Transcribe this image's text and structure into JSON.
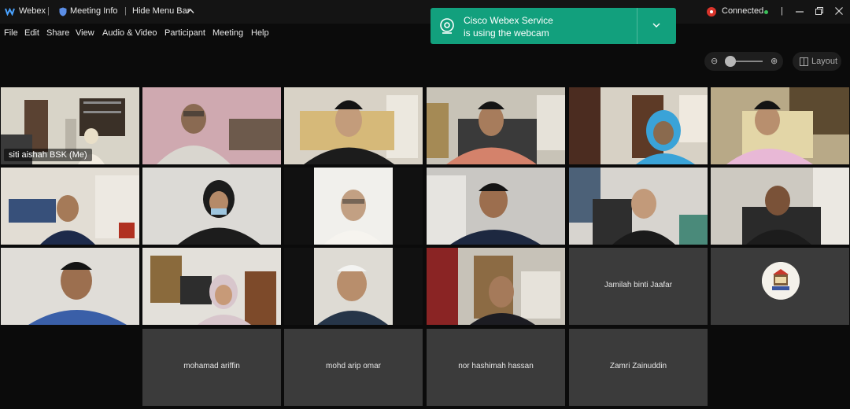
{
  "titlebar": {
    "app_name": "Webex",
    "meeting_info": "Meeting Info",
    "hide_menu": "Hide Menu Bar",
    "status": "Connected"
  },
  "menu": [
    "File",
    "Edit",
    "Share",
    "View",
    "Audio & Video",
    "Participant",
    "Meeting",
    "Help"
  ],
  "toast": {
    "line1": "Cisco Webex Service",
    "line2": "is using the webcam",
    "color": "#12a07d"
  },
  "layout_label": "Layout",
  "colors": {
    "self_outline": "#3aa7d6",
    "status_red": "#d9342b",
    "status_green": "#3cbf5b"
  },
  "participants": {
    "self_label": "siti aishah BSK (Me)",
    "names_without_video": [
      "Jamilah binti Jaafar",
      "mohamad ariffin",
      "mohd arip omar",
      "nor hashimah hassan",
      "Zamri Zainuddin"
    ]
  }
}
